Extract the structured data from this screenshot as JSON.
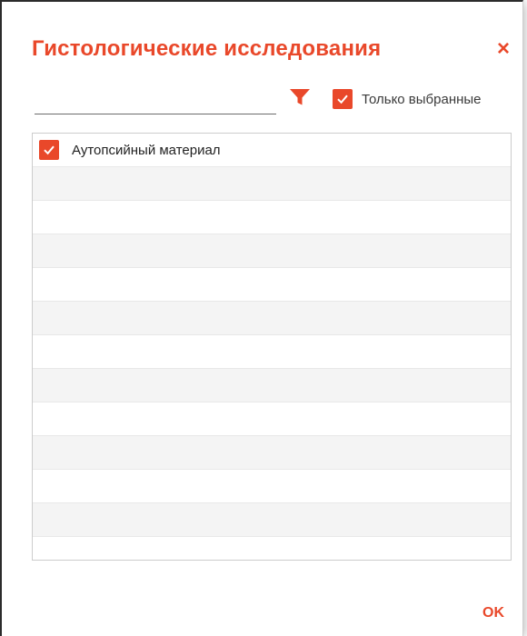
{
  "dialog": {
    "title": "Гистологические исследования",
    "close_symbol": "×",
    "ok_label": "OK"
  },
  "search": {
    "value": "",
    "placeholder": ""
  },
  "filter": {
    "icon": "filter-icon",
    "only_selected_label": "Только выбранные",
    "only_selected_checked": true
  },
  "list": {
    "items": [
      {
        "label": "Аутопсийный материал",
        "checked": true
      }
    ]
  },
  "colors": {
    "accent": "#e9482a",
    "row_alt": "#f4f4f4",
    "border": "#cccccc"
  }
}
